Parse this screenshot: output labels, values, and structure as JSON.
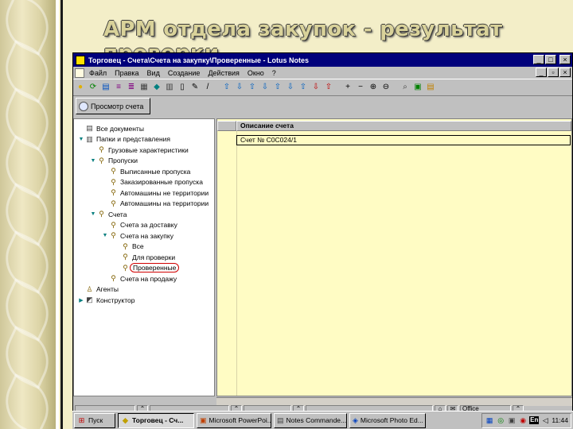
{
  "slide": {
    "title": "АРМ отдела закупок - результат проверки"
  },
  "window": {
    "title": "Торговец - Счета\\Счета на закупку\\Проверенные - Lotus Notes",
    "buttons": {
      "minimize": "_",
      "maximize": "□",
      "close": "×"
    }
  },
  "menu": {
    "items": [
      "Файл",
      "Правка",
      "Вид",
      "Создание",
      "Действия",
      "Окно",
      "?"
    ]
  },
  "action_bar": {
    "button_label": "Просмотр счета"
  },
  "nav": {
    "items": [
      {
        "label": "Все документы",
        "level": 0,
        "twisty": "",
        "icon": "docs-icon"
      },
      {
        "label": "Папки и представления",
        "level": 0,
        "twisty": "▼",
        "icon": "views-icon"
      },
      {
        "label": "Грузовые характеристики",
        "level": 1,
        "twisty": "",
        "icon": "view-icon"
      },
      {
        "label": "Пропуски",
        "level": 1,
        "twisty": "▼",
        "icon": "view-icon"
      },
      {
        "label": "Выписанные пропуска",
        "level": 2,
        "twisty": "",
        "icon": "view-icon"
      },
      {
        "label": "Заказированные пропуска",
        "level": 2,
        "twisty": "",
        "icon": "view-icon"
      },
      {
        "label": "Автомашины не территории",
        "level": 2,
        "twisty": "",
        "icon": "view-icon"
      },
      {
        "label": "Автомашины на территории",
        "level": 2,
        "twisty": "",
        "icon": "view-icon"
      },
      {
        "label": "Счета",
        "level": 1,
        "twisty": "▼",
        "icon": "view-icon"
      },
      {
        "label": "Счета за доставку",
        "level": 2,
        "twisty": "",
        "icon": "view-icon"
      },
      {
        "label": "Счета на закупку",
        "level": 2,
        "twisty": "▼",
        "icon": "view-icon"
      },
      {
        "label": "Все",
        "level": 3,
        "twisty": "",
        "icon": "view-icon"
      },
      {
        "label": "Для проверки",
        "level": 3,
        "twisty": "",
        "icon": "view-icon"
      },
      {
        "label": "Проверенные",
        "level": 3,
        "twisty": "",
        "icon": "view-icon",
        "selected": true
      },
      {
        "label": "Счета на продажу",
        "level": 2,
        "twisty": "",
        "icon": "view-icon"
      },
      {
        "label": "Агенты",
        "level": 0,
        "twisty": "",
        "icon": "agent-icon"
      },
      {
        "label": "Конструктор",
        "level": 0,
        "twisty": "▶",
        "icon": "design-icon"
      }
    ]
  },
  "view": {
    "column_header": "Описание счета",
    "rows": [
      "Счет № C0C024/1"
    ]
  },
  "status": {
    "office": "Office"
  },
  "taskbar": {
    "start": "Пуск",
    "tasks": [
      {
        "label": "Торговец - Сч...",
        "active": true
      },
      {
        "label": "Microsoft PowerPoi..."
      },
      {
        "label": "Notes Commande..."
      },
      {
        "label": "Microsoft Photo Ed..."
      }
    ],
    "lang": "En",
    "clock": "11:44"
  }
}
